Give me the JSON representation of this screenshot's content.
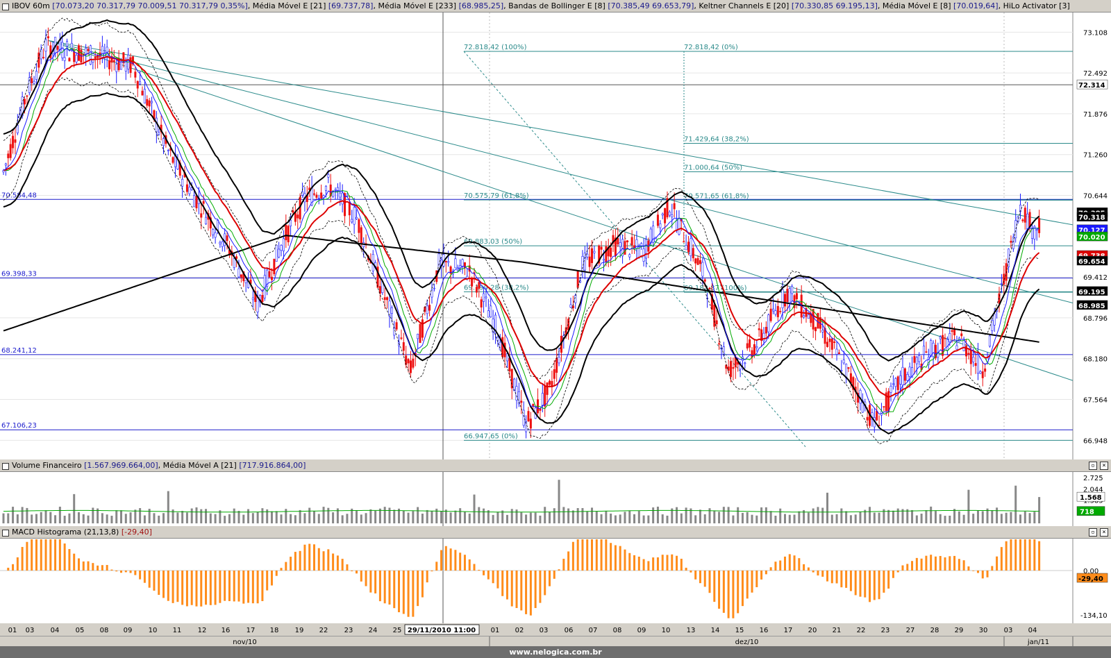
{
  "header_main": {
    "symbol": "IBOV 60m",
    "ohlc": "[70.073,20  70.317,79  70.009,51  70.317,79  0,35%]",
    "ind1_name": "Média Móvel E [21]",
    "ind1_val": "[69.737,78]",
    "ind2_name": "Média Móvel E [233]",
    "ind2_val": "[68.985,25]",
    "ind3_name": "Bandas de Bollinger E [8]",
    "ind3_val": "[70.385,49  69.653,79]",
    "ind4_name": "Keltner Channels E [20]",
    "ind4_val": "[70.330,85  69.195,13]",
    "ind5_name": "Média Móvel E [8]",
    "ind5_val": "[70.019,64]",
    "ind6_name": "HiLo Activator [3]"
  },
  "header_volume": {
    "name": "Volume Financeiro",
    "val": "[1.567.969.664,00]",
    "ma_name": "Média Móvel A [21]",
    "ma_val": "[717.916.864,00]"
  },
  "header_macd": {
    "name": "MACD Histograma (21,13,8)",
    "val": "[-29,40]"
  },
  "price_axis": [
    "73.108",
    "72.492",
    "71.876",
    "71.260",
    "70.644",
    "69.412",
    "68.796",
    "68.180",
    "67.564",
    "66.948"
  ],
  "price_tags": [
    {
      "text": "72.314",
      "bg": "#ffffff",
      "fg": "#000000"
    },
    {
      "text": "70.385",
      "bg": "#000000",
      "fg": "#ffffff"
    },
    {
      "text": "70.318",
      "bg": "#000000",
      "fg": "#ffffff"
    },
    {
      "text": "70.127",
      "bg": "#1a1aff",
      "fg": "#ffffff"
    },
    {
      "text": "70.020",
      "bg": "#00aa00",
      "fg": "#ffffff"
    },
    {
      "text": "69.738",
      "bg": "#dd0000",
      "fg": "#ffffff"
    },
    {
      "text": "69.654",
      "bg": "#000000",
      "fg": "#ffffff"
    },
    {
      "text": "69.195",
      "bg": "#000000",
      "fg": "#ffffff"
    },
    {
      "text": "68.985",
      "bg": "#000000",
      "fg": "#ffffff"
    }
  ],
  "hlines_labels": [
    "70.584,48",
    "69.398,33",
    "68.241,12",
    "67.106,23"
  ],
  "fib_left": [
    "72.818,42 (100%)",
    "70.575,79 (61,8%)",
    "69.883,03 (50%)",
    "69.190,28 (38,2%)",
    "66.947,65 (0%)"
  ],
  "fib_right": [
    "72.818,42 (0%)",
    "71.429,64 (38,2%)",
    "71.000,64 (50%)",
    "70.571,65 (61,8%)",
    "69.182,87 (100%)"
  ],
  "volume_axis": [
    "2.725",
    "2.044",
    "1.385"
  ],
  "volume_tags": [
    {
      "text": "1.568",
      "bg": "#ffffff",
      "fg": "#000000"
    },
    {
      "text": "718",
      "bg": "#00aa00",
      "fg": "#ffffff"
    }
  ],
  "macd_axis": [
    "0.00",
    "-134,10"
  ],
  "macd_tag": {
    "text": "-29,40",
    "bg": "#ff8c1a",
    "fg": "#000000"
  },
  "date_axis": [
    "01",
    "03",
    "04",
    "05",
    "08",
    "09",
    "10",
    "11",
    "12",
    "16",
    "17",
    "18",
    "19",
    "22",
    "23",
    "24",
    "25",
    "01",
    "02",
    "03",
    "06",
    "07",
    "08",
    "09",
    "10",
    "13",
    "14",
    "15",
    "16",
    "17",
    "20",
    "21",
    "22",
    "23",
    "27",
    "28",
    "29",
    "30",
    "03",
    "04"
  ],
  "cursor_label": "29/11/2010 11:00",
  "months": [
    "nov/10",
    "dez/10",
    "jan/11"
  ],
  "footer": "www.nelogica.com.br",
  "colors": {
    "ema21": "#dd0000",
    "ema8": "#1a1aff",
    "hilo": "#00aa00",
    "macd": "#ff8c1a",
    "trend": "#2a8a8a",
    "hline": "#1a1acc"
  }
}
